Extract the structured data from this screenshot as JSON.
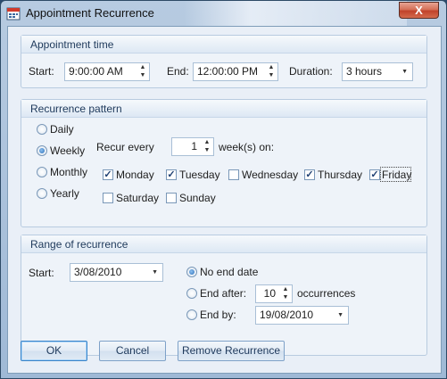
{
  "window": {
    "title": "Appointment Recurrence",
    "close_label": "X",
    "close_icon": "close-icon"
  },
  "appointment_time": {
    "header": "Appointment time",
    "start_label": "Start:",
    "start_value": "9:00:00 AM",
    "end_label": "End:",
    "end_value": "12:00:00 PM",
    "duration_label": "Duration:",
    "duration_value": "3 hours"
  },
  "recurrence_pattern": {
    "header": "Recurrence pattern",
    "frequency": [
      {
        "label": "Daily",
        "selected": false
      },
      {
        "label": "Weekly",
        "selected": true
      },
      {
        "label": "Monthly",
        "selected": false
      },
      {
        "label": "Yearly",
        "selected": false
      }
    ],
    "recur_every_label": "Recur every",
    "recur_every_value": "1",
    "weeks_on_label": "week(s) on:",
    "days": [
      {
        "label": "Monday",
        "checked": true
      },
      {
        "label": "Tuesday",
        "checked": true
      },
      {
        "label": "Wednesday",
        "checked": false
      },
      {
        "label": "Thursday",
        "checked": true
      },
      {
        "label": "Friday",
        "checked": true
      },
      {
        "label": "Saturday",
        "checked": false
      },
      {
        "label": "Sunday",
        "checked": false
      }
    ]
  },
  "range": {
    "header": "Range of recurrence",
    "start_label": "Start:",
    "start_value": "3/08/2010",
    "no_end_label": "No end date",
    "end_after_label": "End after:",
    "end_after_value": "10",
    "occurrences_label": "occurrences",
    "end_by_label": "End by:",
    "end_by_value": "19/08/2010",
    "selected": "no_end"
  },
  "buttons": {
    "ok": "OK",
    "cancel": "Cancel",
    "remove": "Remove Recurrence"
  },
  "colors": {
    "accent": "#1e395b",
    "close": "#c0422a",
    "radio_fill": "#2a6db8"
  }
}
